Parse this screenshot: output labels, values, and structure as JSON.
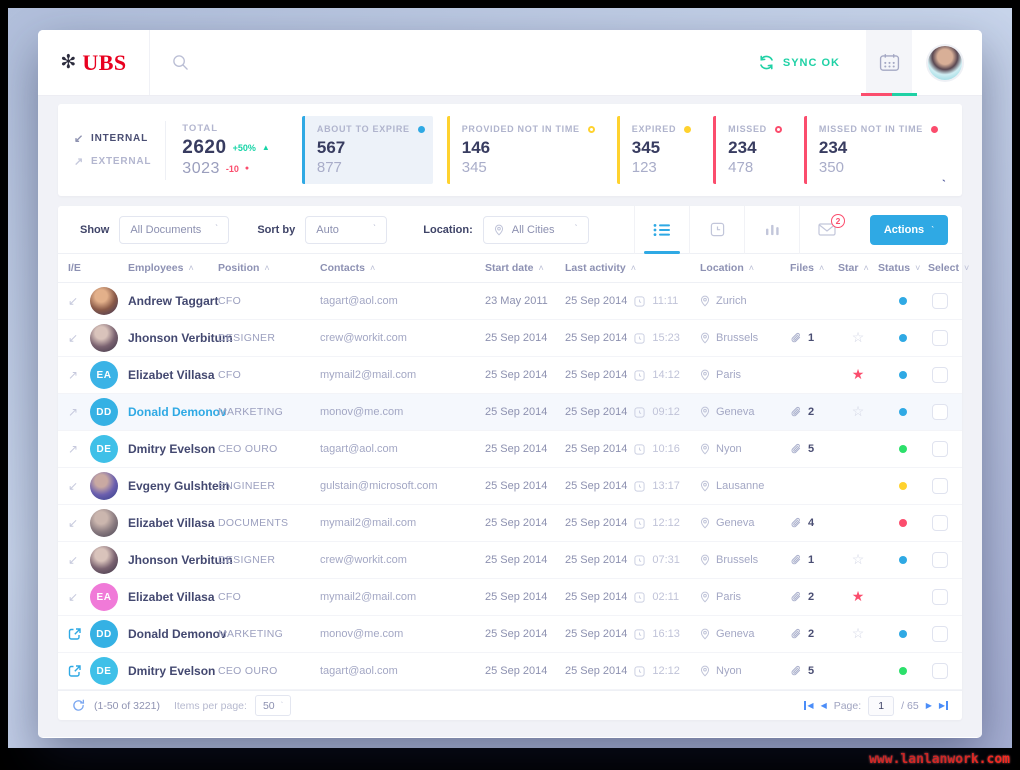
{
  "watermark": "www.lanlanwork.com",
  "header": {
    "brand": "UBS",
    "sync_label": "SYNC OK"
  },
  "stats": {
    "internal_label": "INTERNAL",
    "external_label": "EXTERNAL",
    "total_label": "TOTAL",
    "internal_total": "2620",
    "internal_delta": "+50%",
    "external_total": "3023",
    "external_delta": "-10",
    "accent_up_color": "#17d4a7",
    "accent_down_color": "#fb4d6d",
    "cards": [
      {
        "label": "ABOUT TO EXPIRE",
        "dot": "filled",
        "color": "#2fa9e4",
        "value1": "567",
        "value2": "877",
        "selected": true
      },
      {
        "label": "PROVIDED NOT IN TIME",
        "dot": "outline",
        "color": "#ffd22e",
        "value1": "146",
        "value2": "345",
        "selected": false
      },
      {
        "label": "EXPIRED",
        "dot": "filled",
        "color": "#ffd22e",
        "value1": "345",
        "value2": "123",
        "selected": false
      },
      {
        "label": "MISSED",
        "dot": "outline",
        "color": "#fb4d6d",
        "value1": "234",
        "value2": "478",
        "selected": false
      },
      {
        "label": "MISSED NOT IN TIME",
        "dot": "filled",
        "color": "#fb4d6d",
        "value1": "234",
        "value2": "350",
        "selected": false
      }
    ]
  },
  "filters": {
    "show_label": "Show",
    "show_value": "All Documents",
    "sort_label": "Sort by",
    "sort_value": "Auto",
    "location_label": "Location:",
    "location_value": "All Cities",
    "mail_badge": "2",
    "actions_label": "Actions"
  },
  "table": {
    "headers": [
      {
        "label": "I/E",
        "dir": ""
      },
      {
        "label": "Employees",
        "dir": "up"
      },
      {
        "label": "Position",
        "dir": "up"
      },
      {
        "label": "Contacts",
        "dir": "up"
      },
      {
        "label": "Start date",
        "dir": "up"
      },
      {
        "label": "Last activity",
        "dir": "up"
      },
      {
        "label": "Location",
        "dir": "up"
      },
      {
        "label": "Files",
        "dir": "up"
      },
      {
        "label": "Star",
        "dir": "up"
      },
      {
        "label": "Status",
        "dir": "down"
      },
      {
        "label": "Select",
        "dir": "down"
      }
    ],
    "rows": [
      {
        "direction": "internal",
        "avatar": {
          "type": "photo",
          "colors": [
            "#e3b08a",
            "#8a5a48",
            "#39355a"
          ]
        },
        "name": "Andrew Taggart",
        "position": "CFO",
        "contact": "tagart@aol.com",
        "start_date": "23 May 2011",
        "activity_date": "25 Sep 2014",
        "activity_time": "11:11",
        "location": "Zurich",
        "files": "",
        "star": "none",
        "status_color": "#2fa9e4",
        "highlighted": false
      },
      {
        "direction": "internal",
        "avatar": {
          "type": "photo",
          "colors": [
            "#d9c3bb",
            "#7a6270",
            "#3a3344"
          ]
        },
        "name": "Jhonson Verbitum",
        "position": "DESIGNER",
        "contact": "crew@workit.com",
        "start_date": "25 Sep 2014",
        "activity_date": "25 Sep 2014",
        "activity_time": "15:23",
        "location": "Brussels",
        "files": "1",
        "star": "outline",
        "status_color": "#2fa9e4",
        "highlighted": false
      },
      {
        "direction": "external",
        "avatar": {
          "type": "initials",
          "text": "EA",
          "color": "#3bb3e6"
        },
        "name": "Elizabet Villasa",
        "position": "CFO",
        "contact": "mymail2@mail.com",
        "start_date": "25 Sep 2014",
        "activity_date": "25 Sep 2014",
        "activity_time": "14:12",
        "location": "Paris",
        "files": "",
        "star": "filled",
        "status_color": "#2fa9e4",
        "highlighted": false
      },
      {
        "direction": "external",
        "avatar": {
          "type": "initials",
          "text": "DD",
          "color": "#35b1e4"
        },
        "name": "Donald Demonov",
        "position": "MARKETING",
        "contact": "monov@me.com",
        "start_date": "25 Sep 2014",
        "activity_date": "25 Sep 2014",
        "activity_time": "09:12",
        "location": "Geneva",
        "files": "2",
        "star": "outline",
        "status_color": "#2fa9e4",
        "highlighted": true
      },
      {
        "direction": "external",
        "avatar": {
          "type": "initials",
          "text": "DE",
          "color": "#3fc0e8"
        },
        "name": "Dmitry Evelson",
        "position": "CEO OURO",
        "contact": "tagart@aol.com",
        "start_date": "25 Sep 2014",
        "activity_date": "25 Sep 2014",
        "activity_time": "10:16",
        "location": "Nyon",
        "files": "5",
        "star": "none",
        "status_color": "#2ce06b",
        "highlighted": false
      },
      {
        "direction": "internal",
        "avatar": {
          "type": "photo",
          "colors": [
            "#c9a9a2",
            "#6b5fae",
            "#2e3c86"
          ]
        },
        "name": "Evgeny Gulshtein",
        "position": "ENGINEER",
        "contact": "gulstain@microsoft.com",
        "start_date": "25 Sep 2014",
        "activity_date": "25 Sep 2014",
        "activity_time": "13:17",
        "location": "Lausanne",
        "files": "",
        "star": "none",
        "status_color": "#ffd22e",
        "highlighted": false
      },
      {
        "direction": "internal",
        "avatar": {
          "type": "photo",
          "colors": [
            "#cbb6ae",
            "#8a7b80",
            "#474352"
          ]
        },
        "name": "Elizabet Villasa",
        "position": "DOCUMENTS",
        "contact": "mymail2@mail.com",
        "start_date": "25 Sep 2014",
        "activity_date": "25 Sep 2014",
        "activity_time": "12:12",
        "location": "Geneva",
        "files": "4",
        "star": "none",
        "status_color": "#fb4d6d",
        "highlighted": false
      },
      {
        "direction": "internal",
        "avatar": {
          "type": "photo",
          "colors": [
            "#d9c3bb",
            "#7a6270",
            "#3a3344"
          ]
        },
        "name": "Jhonson Verbitum",
        "position": "DESIGNER",
        "contact": "crew@workit.com",
        "start_date": "25 Sep 2014",
        "activity_date": "25 Sep 2014",
        "activity_time": "07:31",
        "location": "Brussels",
        "files": "1",
        "star": "outline",
        "status_color": "#2fa9e4",
        "highlighted": false
      },
      {
        "direction": "internal",
        "avatar": {
          "type": "initials",
          "text": "EA",
          "color": "#f07ad8"
        },
        "name": "Elizabet Villasa",
        "position": "CFO",
        "contact": "mymail2@mail.com",
        "start_date": "25 Sep 2014",
        "activity_date": "25 Sep 2014",
        "activity_time": "02:11",
        "location": "Paris",
        "files": "2",
        "star": "filled",
        "status_color": "",
        "highlighted": false
      },
      {
        "direction": "link",
        "avatar": {
          "type": "initials",
          "text": "DD",
          "color": "#35b1e4"
        },
        "name": "Donald Demonov",
        "position": "MARKETING",
        "contact": "monov@me.com",
        "start_date": "25 Sep 2014",
        "activity_date": "25 Sep 2014",
        "activity_time": "16:13",
        "location": "Geneva",
        "files": "2",
        "star": "outline",
        "status_color": "#2fa9e4",
        "highlighted": false
      },
      {
        "direction": "link",
        "avatar": {
          "type": "initials",
          "text": "DE",
          "color": "#3fc0e8"
        },
        "name": "Dmitry Evelson",
        "position": "CEO OURO",
        "contact": "tagart@aol.com",
        "start_date": "25 Sep 2014",
        "activity_date": "25 Sep 2014",
        "activity_time": "12:12",
        "location": "Nyon",
        "files": "5",
        "star": "none",
        "status_color": "#2ce06b",
        "highlighted": false
      }
    ]
  },
  "footer": {
    "range": "(1-50 of 3221)",
    "per_page_label": "Items per page:",
    "per_page_value": "50",
    "page_label": "Page:",
    "page_value": "1",
    "pages_total": "/ 65"
  }
}
